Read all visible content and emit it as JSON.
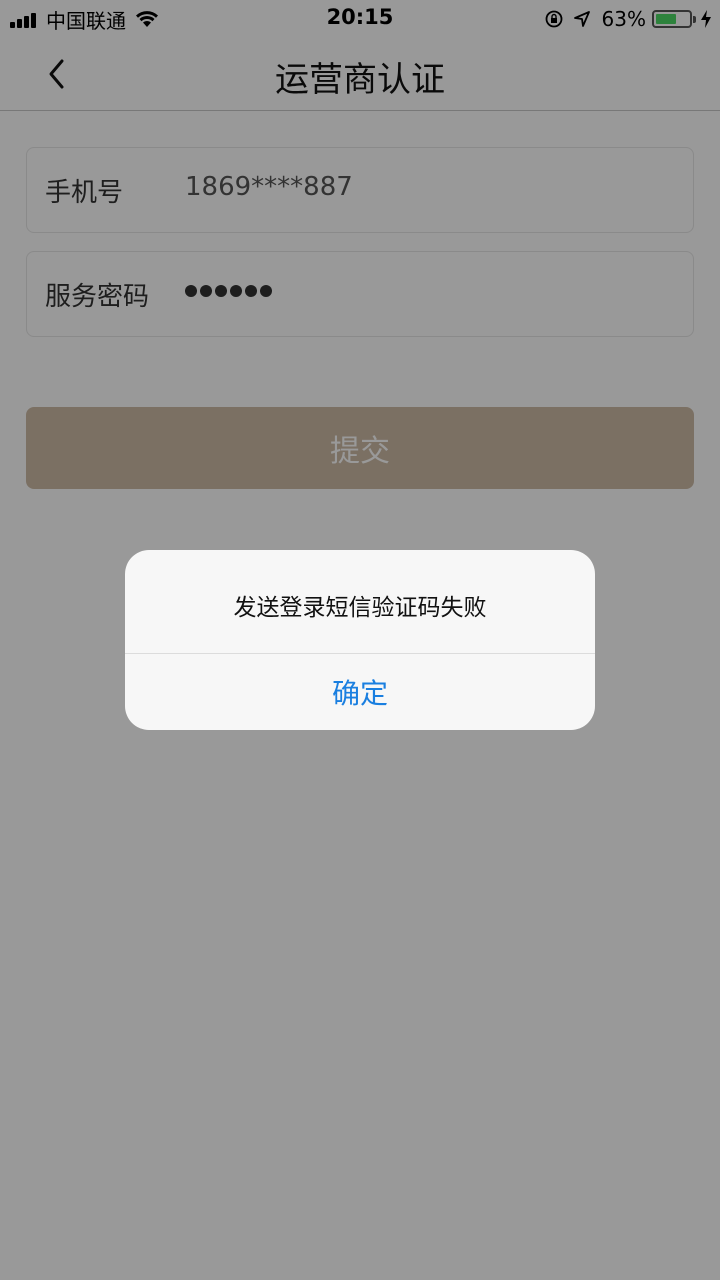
{
  "status_bar": {
    "carrier": "中国联通",
    "time": "20:15",
    "battery_percent": "63%",
    "battery_level": 0.63,
    "icons": [
      "signal-icon",
      "wifi-icon",
      "rotation-lock-icon",
      "location-icon",
      "battery-icon",
      "charging-bolt-icon"
    ]
  },
  "nav": {
    "back_icon": "chevron-left-icon",
    "title": "运营商认证"
  },
  "form": {
    "phone_label": "手机号",
    "phone_value": "1869****887",
    "password_label": "服务密码",
    "password_mask_count": 6,
    "submit_label": "提交"
  },
  "alert": {
    "message": "发送登录短信验证码失败",
    "confirm_label": "确定"
  },
  "colors": {
    "submit_button": "#cdbba6",
    "alert_button_text": "#1a7fe0",
    "overlay": "rgba(0,0,0,0.4)",
    "battery_fill": "#4cd964"
  }
}
